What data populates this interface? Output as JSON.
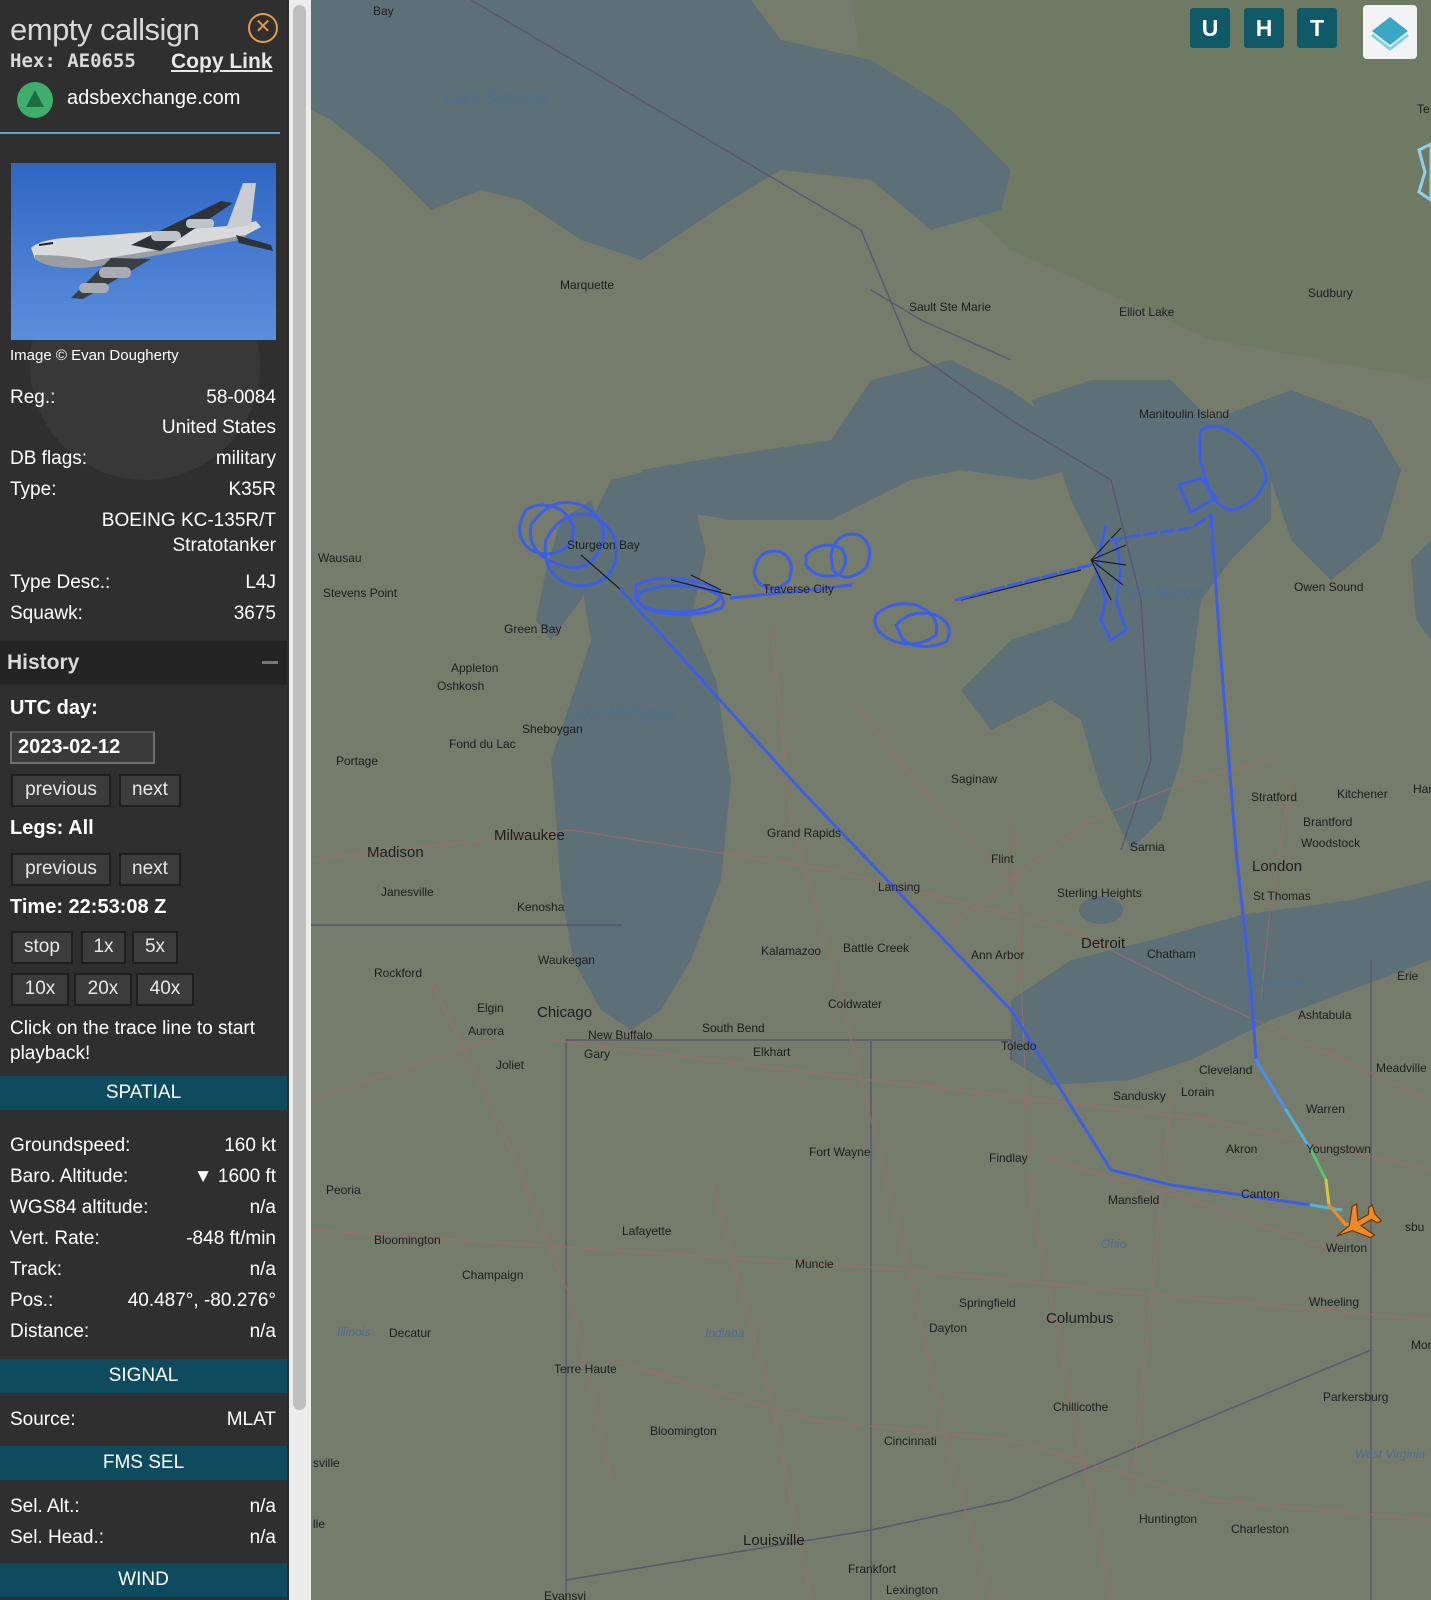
{
  "sidebar": {
    "callsign": "empty callsign",
    "hex_label": "Hex:",
    "hex_value": "AE0655",
    "copy_link": "Copy Link",
    "source_site": "adsbexchange.com",
    "photo_credit": "Image © Evan Dougherty",
    "details": {
      "reg_label": "Reg.:",
      "reg_value": "58-0084",
      "country": "United States",
      "dbflags_label": "DB flags:",
      "dbflags_value": "military",
      "type_label": "Type:",
      "type_value": "K35R",
      "type_name_1": "BOEING KC-135R/T",
      "type_name_2": "Stratotanker",
      "typedesc_label": "Type Desc.:",
      "typedesc_value": "L4J",
      "squawk_label": "Squawk:",
      "squawk_value": "3675"
    },
    "history": {
      "title": "History",
      "utc_day_label": "UTC day:",
      "date": "2023-02-12",
      "prev": "previous",
      "next": "next",
      "legs_label": "Legs: All",
      "time_label": "Time: 22:53:08 Z",
      "stop": "stop",
      "speeds": [
        "1x",
        "5x",
        "10x",
        "20x",
        "40x"
      ],
      "hint": "Click on the trace line to start playback!"
    },
    "spatial": {
      "title": "SPATIAL",
      "groundspeed_label": "Groundspeed:",
      "groundspeed_value": "160 kt",
      "baro_label": "Baro. Altitude:",
      "baro_value": "▼ 1600 ft",
      "wgs_label": "WGS84 altitude:",
      "wgs_value": "n/a",
      "vrate_label": "Vert. Rate:",
      "vrate_value": "-848 ft/min",
      "track_label": "Track:",
      "track_value": "n/a",
      "pos_label": "Pos.:",
      "pos_value": "40.487°, -80.276°",
      "distance_label": "Distance:",
      "distance_value": "n/a"
    },
    "signal": {
      "title": "SIGNAL",
      "source_label": "Source:",
      "source_value": "MLAT"
    },
    "fms": {
      "title": "FMS SEL",
      "selalt_label": "Sel. Alt.:",
      "selalt_value": "n/a",
      "selhead_label": "Sel. Head.:",
      "selhead_value": "n/a"
    },
    "wind": {
      "title": "WIND"
    }
  },
  "map": {
    "controls": [
      "U",
      "H",
      "T"
    ],
    "water_labels": [
      "Lake Superior",
      "Lake Michigan",
      "Lake Huron",
      "Lake Erie"
    ],
    "cities": [
      "Bay",
      "Marquette",
      "Sault Ste Marie",
      "Elliot Lake",
      "Sudbury",
      "Manitoulin Island",
      "Wausau",
      "Stevens Point",
      "Sturgeon Bay",
      "Traverse City",
      "Green Bay",
      "Appleton",
      "Oshkosh",
      "Owen Sound",
      "Sheboygan",
      "Fond du Lac",
      "Portage",
      "Saginaw",
      "Stratford",
      "Kitchener",
      "Brantford",
      "Woodstock",
      "Madison",
      "Milwaukee",
      "Grand Rapids",
      "Flint",
      "Sarnia",
      "London",
      "St Thomas",
      "Janesville",
      "Kenosha",
      "Lansing",
      "Sterling Heights",
      "Detroit",
      "Waukegan",
      "Kalamazoo",
      "Battle Creek",
      "Ann Arbor",
      "Chatham",
      "Rockford",
      "Erie",
      "Elgin",
      "Chicago",
      "Coldwater",
      "Ashtabula",
      "Aurora",
      "New Buffalo",
      "South Bend",
      "Elkhart",
      "Toledo",
      "Cleveland",
      "Meadville",
      "Joliet",
      "Gary",
      "Sandusky",
      "Lorain",
      "Warren",
      "Fort Wayne",
      "Findlay",
      "Akron",
      "Youngstown",
      "Peoria",
      "Mansfield",
      "Canton",
      "Lafayette",
      "Ohio",
      "Weirton",
      "Bloomington",
      "Champaign",
      "Muncie",
      "Springfield",
      "Wheeling",
      "Columbus",
      "Dayton",
      "Illinois",
      "Decatur",
      "Indiana",
      "Terre Haute",
      "Parkersburg",
      "Chillicothe",
      "Bloomington",
      "Cincinnati",
      "West Virginia",
      "Huntington",
      "Charleston",
      "Louisville",
      "Frankfort",
      "Lexington",
      "Ham",
      "Morgan",
      "Te",
      "sville",
      "lle",
      "sbu",
      "Evansvi"
    ],
    "trail_colors": {
      "blue": "#3d5fe6",
      "light_blue": "#4a8cf0",
      "cyan": "#4fb6d6",
      "green": "#58c46a",
      "yellow": "#d9c43a",
      "orange": "#f08a24"
    }
  }
}
